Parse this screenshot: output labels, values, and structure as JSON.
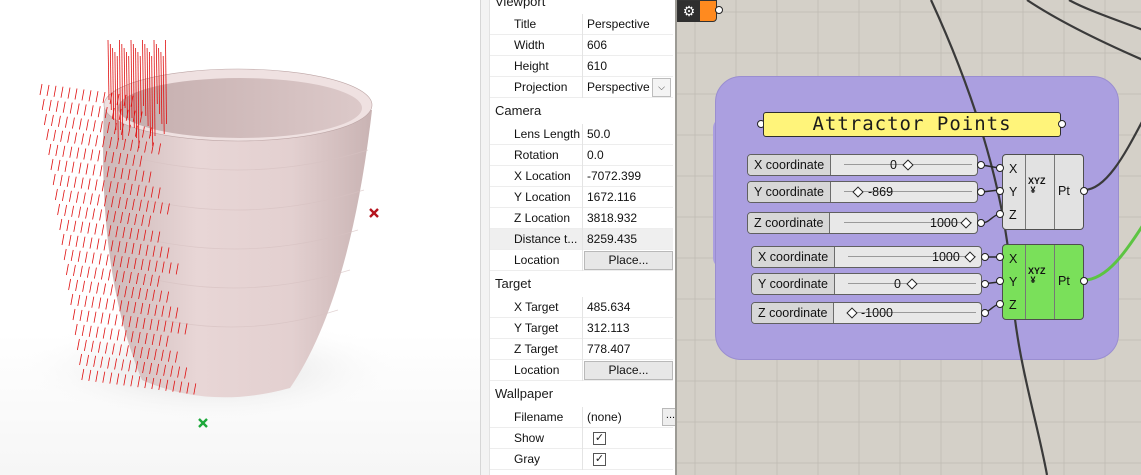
{
  "properties": {
    "viewport_section": "Viewport",
    "viewport": [
      {
        "key": "Title",
        "value": "Perspective"
      },
      {
        "key": "Width",
        "value": "606"
      },
      {
        "key": "Height",
        "value": "610"
      },
      {
        "key": "Projection",
        "value": "Perspective"
      }
    ],
    "camera_section": "Camera",
    "camera": [
      {
        "key": "Lens Length",
        "value": "50.0"
      },
      {
        "key": "Rotation",
        "value": "0.0"
      },
      {
        "key": "X Location",
        "value": "-7072.399"
      },
      {
        "key": "Y Location",
        "value": "1672.116"
      },
      {
        "key": "Z Location",
        "value": "3818.932"
      },
      {
        "key": "Distance t...",
        "value": "8259.435"
      },
      {
        "key": "Location",
        "value": "Place..."
      }
    ],
    "target_section": "Target",
    "target": [
      {
        "key": "X Target",
        "value": "485.634"
      },
      {
        "key": "Y Target",
        "value": "312.113"
      },
      {
        "key": "Z Target",
        "value": "778.407"
      },
      {
        "key": "Location",
        "value": "Place..."
      }
    ],
    "wallpaper_section": "Wallpaper",
    "wallpaper": [
      {
        "key": "Filename",
        "value": "(none)"
      },
      {
        "key": "Show",
        "checked": true
      },
      {
        "key": "Gray",
        "checked": true
      }
    ],
    "dots_label": "...",
    "check_mark": "✓",
    "dropdown_glyph": "⌵"
  },
  "grasshopper": {
    "panel_text": "Attractor Points",
    "group_color": "#ab9fe0",
    "point_component_1": {
      "inputs": [
        "X",
        "Y",
        "Z"
      ],
      "output": "Pt",
      "icon": "xyz-point-icon",
      "color": "#e2e2e2",
      "sliders": [
        {
          "label": "X coordinate",
          "value": "0",
          "level": 0.5
        },
        {
          "label": "Y coordinate",
          "value": "-869",
          "level": 0.07
        },
        {
          "label": "Z coordinate",
          "value": "1000",
          "level": 1.0
        }
      ]
    },
    "point_component_2": {
      "inputs": [
        "X",
        "Y",
        "Z"
      ],
      "output": "Pt",
      "icon": "xyz-point-icon",
      "color": "#7ae05a",
      "sliders": [
        {
          "label": "X coordinate",
          "value": "1000",
          "level": 1.0
        },
        {
          "label": "Y coordinate",
          "value": "0",
          "level": 0.5
        },
        {
          "label": "Z coordinate",
          "value": "-1000",
          "level": 0.0
        }
      ]
    },
    "corner_component_icon": "gear-icon",
    "corner_component_color": "#ff8a1f",
    "wire_selected_color": "#5cc442"
  },
  "scene": {
    "vase_color": "#e6d3d3",
    "vector_color": "#e01010",
    "attractor_point_colors": [
      "#b5141e",
      "#1ca83a"
    ]
  }
}
